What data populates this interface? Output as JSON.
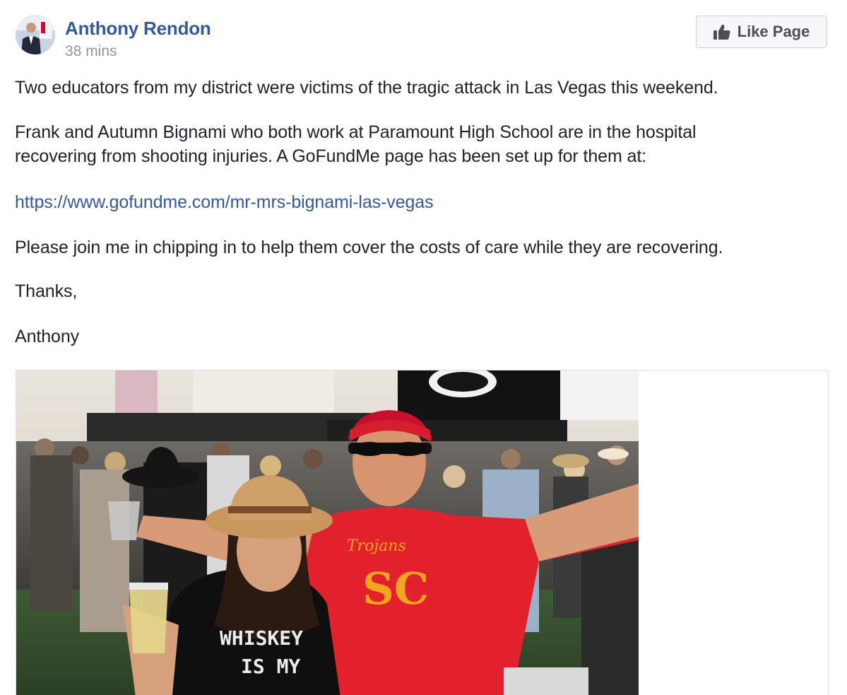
{
  "post": {
    "author": "Anthony Rendon",
    "timestamp": "38 mins",
    "like_button": "Like Page",
    "paragraphs": {
      "p1": "Two educators from my district were victims of the tragic attack in Las Vegas this weekend.",
      "p2_line1": "Frank and Autumn Bignami who both work at Paramount High School are in the hospital",
      "p2_line2": "recovering from shooting injuries. A GoFundMe page has been set up for them at:",
      "link": "https://www.gofundme.com/mr-mrs-bignami-las-vegas",
      "p3": "Please join me in chipping in to help them cover the costs of care while they are recovering.",
      "p4": "Thanks,",
      "p5": "Anthony"
    },
    "photo": {
      "shirt_left_line1": "WHISKEY",
      "shirt_left_line2": "IS MY",
      "shirt_right_script": "Trojans",
      "shirt_right_letters": "SC"
    }
  },
  "colors": {
    "link": "#365899",
    "text": "#1d2129",
    "meta": "#90949c",
    "button_bg": "#f6f7f9",
    "button_text": "#4b4f56"
  },
  "icons": {
    "like_button_icon": "thumbs-up-icon"
  }
}
